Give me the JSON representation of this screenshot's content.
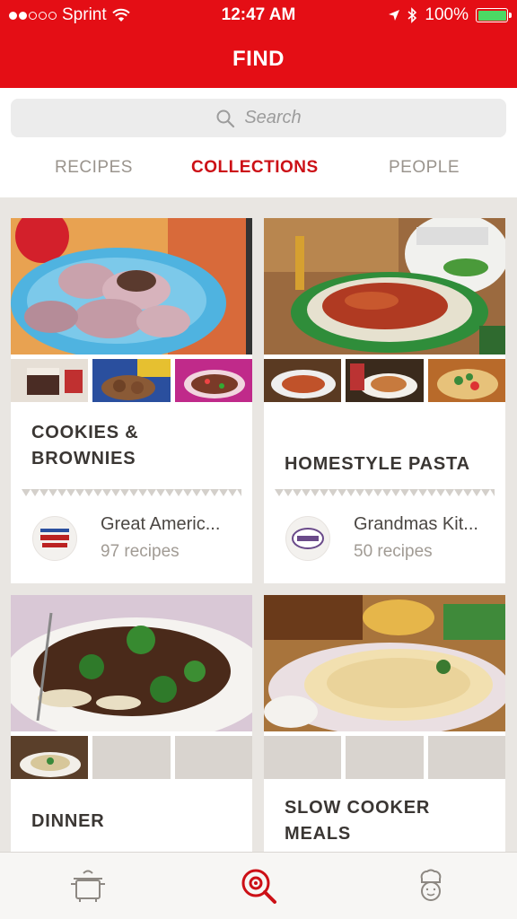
{
  "status": {
    "carrier": "Sprint",
    "time": "12:47 AM",
    "battery": "100%"
  },
  "nav": {
    "title": "FIND"
  },
  "search": {
    "placeholder": "Search"
  },
  "tabs": [
    {
      "label": "RECIPES",
      "active": false
    },
    {
      "label": "COLLECTIONS",
      "active": true
    },
    {
      "label": "PEOPLE",
      "active": false
    }
  ],
  "collections": [
    {
      "title": "COOKIES & BROWNIES",
      "author": "Great Americ...",
      "count": "97 recipes"
    },
    {
      "title": "HOMESTYLE PASTA",
      "author": "Grandmas Kit...",
      "count": "50 recipes"
    },
    {
      "title": "DINNER"
    },
    {
      "title": "SLOW COOKER MEALS"
    }
  ],
  "bottom_tabs": [
    {
      "icon": "cooking-pot-icon"
    },
    {
      "icon": "search-target-icon"
    },
    {
      "icon": "chef-profile-icon"
    }
  ],
  "colors": {
    "brand": "#e40e15",
    "active_tab": "#cc1016"
  }
}
